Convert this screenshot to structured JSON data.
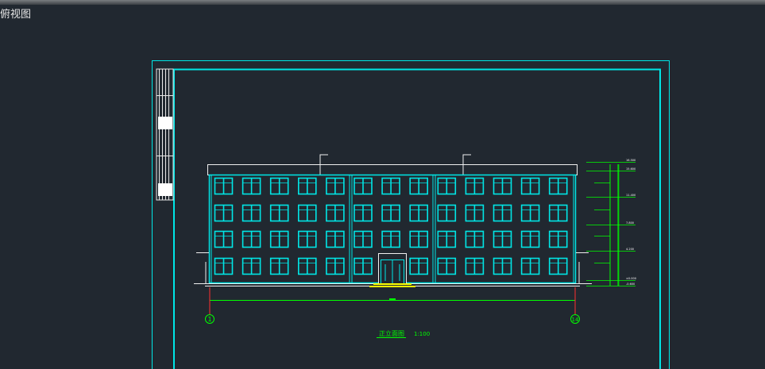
{
  "viewport": {
    "label": "俯视图",
    "background": "#212830"
  },
  "drawing": {
    "title": "正立面图",
    "scale": "1:100",
    "axis_left": "1",
    "axis_right": "14",
    "frame_color": "#00e6e6",
    "dimension_color": "#00ff00",
    "entry_step_color": "#ffff00",
    "floors": 4,
    "window_columns": 13
  },
  "elevation_marks": [
    "16.500",
    "15.600",
    "11.400",
    "7.800",
    "4.200",
    "±0.000",
    "-0.600"
  ]
}
